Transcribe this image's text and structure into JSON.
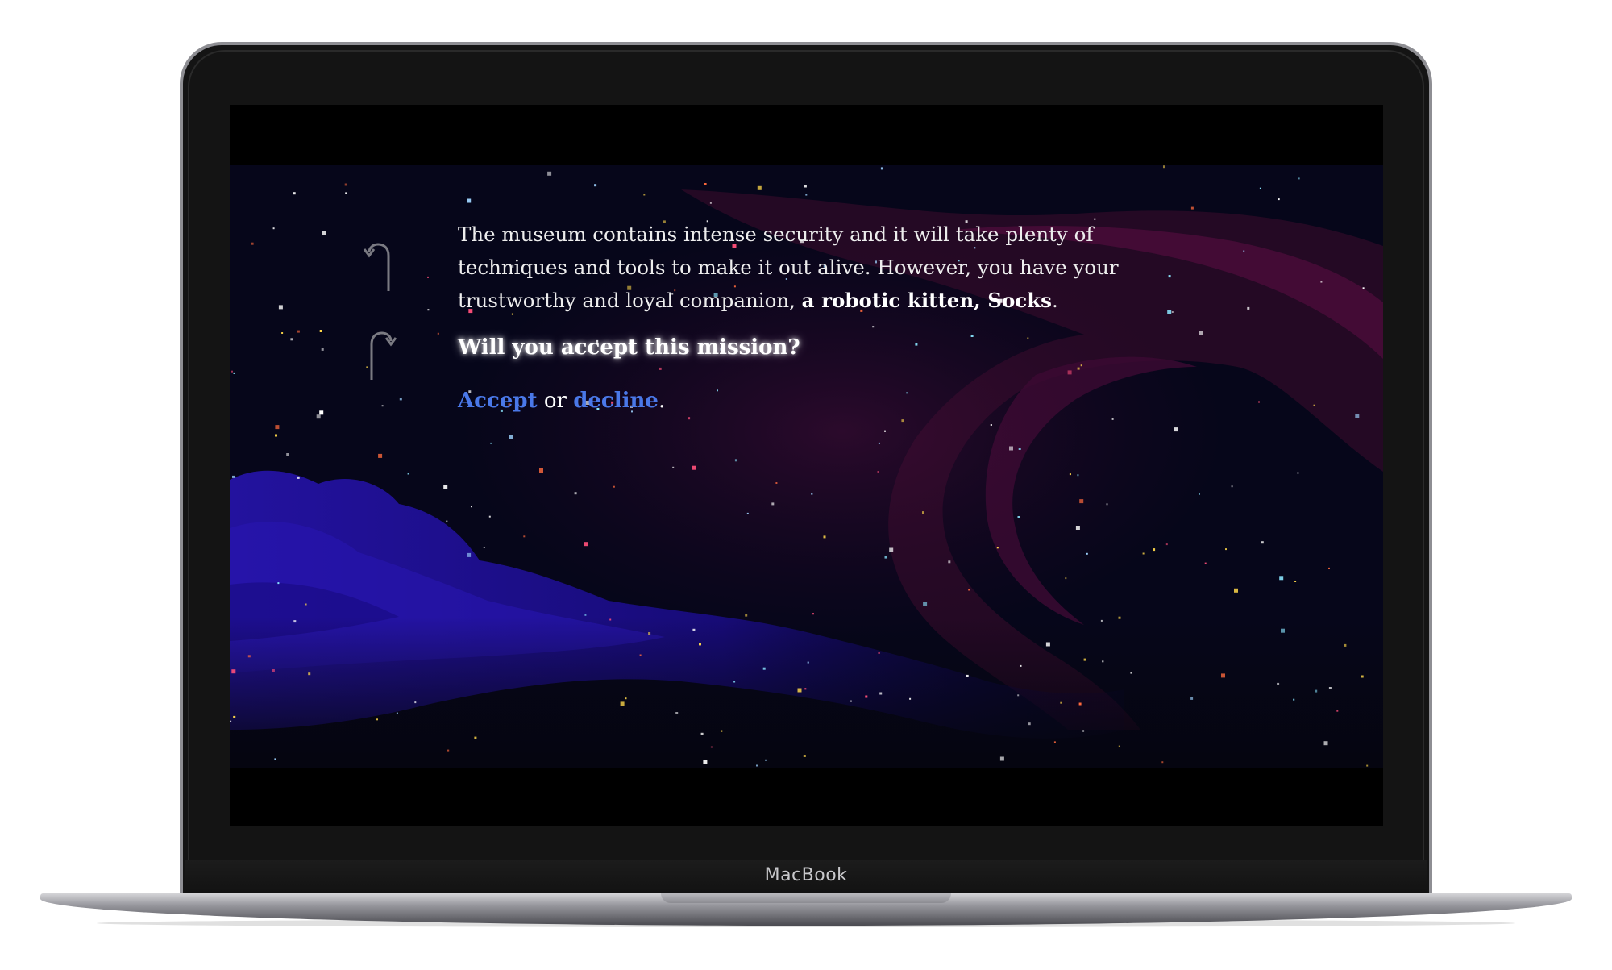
{
  "device": {
    "brand_label": "MacBook"
  },
  "controls": {
    "undo_icon": "undo-arrow-icon",
    "redo_icon": "redo-arrow-icon"
  },
  "story": {
    "paragraph_text": "The museum contains intense security and it will take plenty of techniques and tools to make it out alive. However, you have your trustworthy and loyal companion, ",
    "paragraph_emphasis": "a robotic kitten, Socks",
    "paragraph_end": ".",
    "question": "Will you accept this mission?",
    "accept_label": "Accept",
    "connector": " or ",
    "decline_label": "decline",
    "choices_end": "."
  },
  "colors": {
    "background": "#05050f",
    "link": "#4a78e8",
    "text": "#ededed",
    "nebula_blue": "#1e0e8a",
    "nebula_purple": "#3a0b2e"
  }
}
